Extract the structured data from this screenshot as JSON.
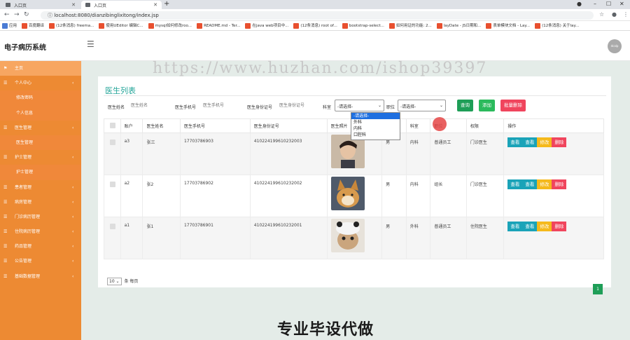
{
  "browser": {
    "tabs": [
      {
        "label": "入口页"
      },
      {
        "label": "入口页"
      }
    ],
    "url": "localhost:8080/dianzibinglixitong/index.jsp",
    "bookmarks": [
      "应用",
      "百度翻译",
      "(12条消息) freema...",
      "使用UEditor 编辑C...",
      "mysql如何修改roo...",
      "README.md - Ter...",
      "在java web项目中...",
      "(12条消息) root of...",
      "bootstrap-select...",
      "如何用证的功能: 2...",
      "layDate - JS日期和...",
      "表单模块文档 - Lay...",
      "(12条消息) 关于lay..."
    ]
  },
  "app": {
    "title": "电子病历系统",
    "avatar_text": "dcalp"
  },
  "watermark": "https://www.huzhan.com/ishop39397",
  "sidebar": {
    "items": [
      {
        "label": "主页",
        "icon": "flag-icon",
        "sub": false,
        "chev": false
      },
      {
        "label": "个人中心",
        "icon": "menu-icon",
        "sub": false,
        "chev": true
      },
      {
        "label": "修改密码",
        "icon": "",
        "sub": true,
        "chev": false
      },
      {
        "label": "个人信息",
        "icon": "",
        "sub": true,
        "chev": false
      },
      {
        "label": "医生管理",
        "icon": "menu-icon",
        "sub": false,
        "chev": true
      },
      {
        "label": "医生管理",
        "icon": "",
        "sub": true,
        "chev": false
      },
      {
        "label": "护士管理",
        "icon": "menu-icon",
        "sub": false,
        "chev": true
      },
      {
        "label": "护士管理",
        "icon": "",
        "sub": true,
        "chev": false
      },
      {
        "label": "患者管理",
        "icon": "menu-icon",
        "sub": false,
        "chev": true
      },
      {
        "label": "病房管理",
        "icon": "menu-icon",
        "sub": false,
        "chev": true
      },
      {
        "label": "门诊病历管理",
        "icon": "menu-icon",
        "sub": false,
        "chev": true
      },
      {
        "label": "住院病历管理",
        "icon": "menu-icon",
        "sub": false,
        "chev": true
      },
      {
        "label": "药品管理",
        "icon": "menu-icon",
        "sub": false,
        "chev": true
      },
      {
        "label": "公告管理",
        "icon": "menu-icon",
        "sub": false,
        "chev": true
      },
      {
        "label": "基础数据管理",
        "icon": "menu-icon",
        "sub": false,
        "chev": true
      }
    ]
  },
  "panel": {
    "title": "医生列表",
    "filters": {
      "name_label": "医生姓名",
      "name_placeholder": "医生姓名",
      "phone_label": "医生手机号",
      "phone_placeholder": "医生手机号",
      "id_label": "医生身份证号",
      "id_placeholder": "医生身份证号",
      "dept_label": "科室",
      "dept_value": "-请选择-",
      "pos_label": "职位",
      "pos_value": "-请选择-"
    },
    "buttons": {
      "search": "查询",
      "add": "添加",
      "batch_delete": "批量删除"
    },
    "dept_options": [
      "-请选择-",
      "外科",
      "内科",
      "口腔科"
    ],
    "columns": [
      "",
      "账户",
      "医生姓名",
      "医生手机号",
      "医生身份证号",
      "医生照片",
      "性别",
      "科室",
      "职位",
      "权限",
      "操作"
    ],
    "rows": [
      {
        "account": "a3",
        "name": "张三",
        "phone": "17703786903",
        "idno": "410224199610232003",
        "photo": "young-man-photo",
        "gender": "男",
        "dept": "内科",
        "position": "普通员工",
        "role": "门诊医生"
      },
      {
        "account": "a2",
        "name": "张2",
        "phone": "17703786902",
        "idno": "410224199610232002",
        "photo": "shiba-dog-photo",
        "gender": "男",
        "dept": "内科",
        "position": "组长",
        "role": "门诊医生"
      },
      {
        "account": "a1",
        "name": "张1",
        "phone": "17703786901",
        "idno": "410224199610232001",
        "photo": "cat-photo",
        "gender": "男",
        "dept": "外科",
        "position": "普通员工",
        "role": "住院医生"
      }
    ],
    "actions": [
      "查看",
      "查看",
      "修改",
      "删除"
    ],
    "pager": {
      "size": "10",
      "suffix": "条 每页",
      "page": "1"
    }
  },
  "promo": "专业毕设代做",
  "colors": {
    "sidebar": "#ed8a33",
    "accent": "#26a69a",
    "btn_search": "#1e9e57",
    "btn_add": "#2bba5c",
    "btn_delete": "#f0455d",
    "btn_view": "#1aa3b8",
    "btn_edit": "#f5b91b"
  }
}
